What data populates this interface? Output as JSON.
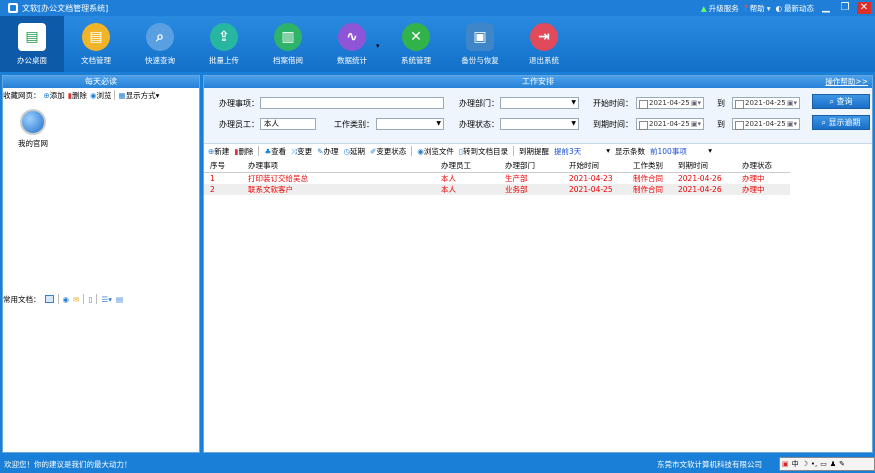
{
  "app": {
    "title": "文软[办公文档管理系统]"
  },
  "titlebar": {
    "upgrade": "升级服务",
    "help": "帮助",
    "news": "最新动态",
    "minimize": "▁",
    "restore": "❐",
    "close": "✕"
  },
  "toolbar": [
    {
      "label": "办公桌面",
      "icon": "desktop-icon",
      "color": "#ffffff",
      "glyph": "▤"
    },
    {
      "label": "文档管理",
      "icon": "document-icon",
      "color": "#f0b429",
      "glyph": "▤"
    },
    {
      "label": "快速查询",
      "icon": "search-icon",
      "color": "#5b9fe3",
      "glyph": "⌕"
    },
    {
      "label": "批量上传",
      "icon": "upload-icon",
      "color": "#27b7a0",
      "glyph": "⇪"
    },
    {
      "label": "档案借阅",
      "icon": "archive-icon",
      "color": "#2fb36a",
      "glyph": "▥"
    },
    {
      "label": "数据统计",
      "icon": "chart-icon",
      "color": "#8e55d6",
      "glyph": "∿"
    },
    {
      "label": "系统管理",
      "icon": "tools-icon",
      "color": "#31b34a",
      "glyph": "✕"
    },
    {
      "label": "备份与恢复",
      "icon": "backup-icon",
      "color": "#3f86c9",
      "glyph": "▣"
    },
    {
      "label": "退出系统",
      "icon": "exit-icon",
      "color": "#e04a5a",
      "glyph": "⇥"
    }
  ],
  "left": {
    "header": "每天必读",
    "fav_label": "收藏网页：",
    "fav_add": "添加",
    "fav_delete": "删除",
    "fav_browse": "浏览",
    "fav_display": "显示方式",
    "website": "我的官网",
    "doc_label": "常用文档："
  },
  "right": {
    "header": "工作安排",
    "help": "操作帮助>>",
    "form": {
      "item_label": "办理事项：",
      "item_value": "",
      "dept_label": "办理部门：",
      "start_label": "开始时间：",
      "start_from": "2021-04-25",
      "to1": "到",
      "start_to": "2021-04-25",
      "query": "查询",
      "staff_label": "办理员工：",
      "staff_value": "本人",
      "type_label": "工作类别：",
      "status_label": "办理状态：",
      "due_label": "到期时间：",
      "due_from": "2021-04-25",
      "to2": "到",
      "due_to": "2021-04-25",
      "show_overdue": "显示逾期"
    },
    "actions": {
      "new": "新建",
      "delete": "删除",
      "view": "查看",
      "change": "变更",
      "handle": "办理",
      "extend": "延期",
      "change_status": "变更状态",
      "browse_file": "浏览文件",
      "goto_dir": "转到文档目录",
      "remind": "到期提醒",
      "remind_value": "提前3天",
      "show_count": "显示条数",
      "count_value": "前100事项"
    },
    "columns": [
      "序号",
      "办理事项",
      "办理员工",
      "办理部门",
      "开始时间",
      "工作类别",
      "到期时间",
      "办理状态"
    ],
    "rows": [
      [
        "1",
        "打印装订交给吴总",
        "本人",
        "生产部",
        "2021-04-23",
        "制作合同",
        "2021-04-26",
        "办理中"
      ],
      [
        "2",
        "联系文软客户",
        "本人",
        "业务部",
        "2021-04-25",
        "制作合同",
        "2021-04-26",
        "办理中"
      ]
    ]
  },
  "status": {
    "welcome": "欢迎您！你的建议是我们的最大动力！",
    "company": "东莞市文软计算机科技有限公司",
    "ime": "中"
  }
}
